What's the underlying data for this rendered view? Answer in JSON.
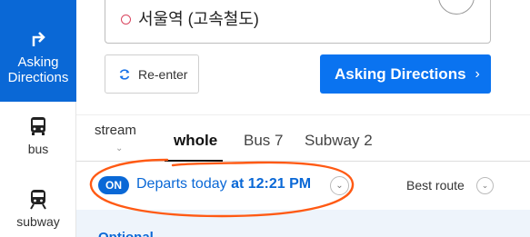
{
  "sidebar": {
    "items": [
      {
        "label": "Asking Directions",
        "icon": "turn-right-arrow-icon",
        "active": true
      },
      {
        "label": "bus",
        "icon": "bus-icon"
      },
      {
        "label": "subway",
        "icon": "subway-icon"
      }
    ]
  },
  "destination": {
    "value": "서울역 (고속철도)"
  },
  "buttons": {
    "reenter_label": "Re-enter",
    "ask_label": "Asking Directions",
    "ask_chevron": "›"
  },
  "filters": {
    "stream_label": "stream",
    "stream_chevron": "⌄",
    "tabs": [
      {
        "label": "whole",
        "active": true
      },
      {
        "label": "Bus 7"
      },
      {
        "label": "Subway 2"
      }
    ]
  },
  "departure": {
    "badge": "ON",
    "text": "Departs today",
    "time": "at 12:21 PM",
    "chevron": "⌄"
  },
  "sort": {
    "label": "Best route",
    "chevron": "⌄"
  },
  "below": {
    "text": "Optional"
  },
  "colors": {
    "accent": "#0a68d6",
    "annotation": "#ff5a14",
    "destination_dot": "#d9455f"
  }
}
